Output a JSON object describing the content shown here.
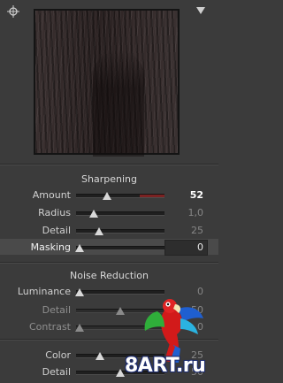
{
  "sharpening": {
    "title": "Sharpening",
    "sliders": [
      {
        "label": "Amount",
        "value": "52",
        "position": 0.35
      },
      {
        "label": "Radius",
        "value": "1,0",
        "position": 0.2
      },
      {
        "label": "Detail",
        "value": "25",
        "position": 0.25
      },
      {
        "label": "Masking",
        "value": "0",
        "position": 0.0
      }
    ]
  },
  "noise_reduction": {
    "title": "Noise Reduction",
    "sliders": [
      {
        "label": "Luminance",
        "value": "0",
        "position": 0.0
      },
      {
        "label": "Detail",
        "value": "50",
        "position": 0.5
      },
      {
        "label": "Contrast",
        "value": "0",
        "position": 0.0
      },
      {
        "label": "Color",
        "value": "25",
        "position": 0.25
      },
      {
        "label": "Detail",
        "value": "50",
        "position": 0.5
      }
    ]
  },
  "watermark": {
    "text": "8ART.ru"
  },
  "colors": {
    "accent_red": "#7a2222",
    "panel_bg": "#3b3b3b"
  }
}
